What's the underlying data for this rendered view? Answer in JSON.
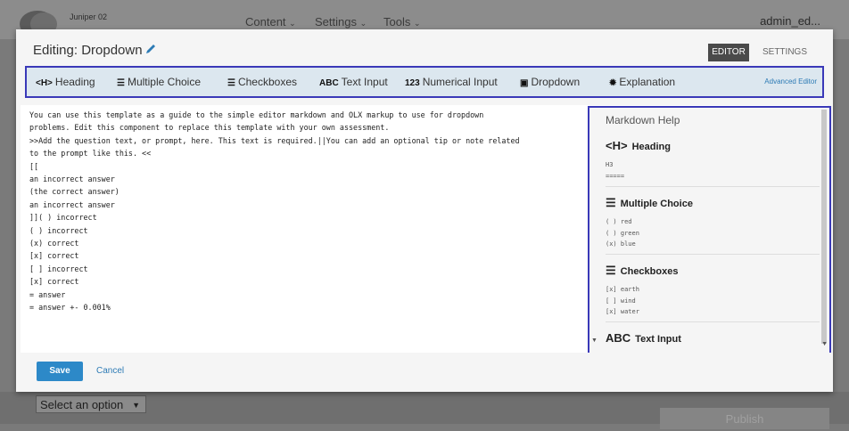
{
  "background": {
    "course_label": "Juniper 02",
    "nav": [
      "Content",
      "Settings",
      "Tools"
    ],
    "user": "admin_ed...",
    "select_value": "Select an option",
    "publish_label": "Publish"
  },
  "modal": {
    "title": "Editing: Dropdown",
    "tabs": {
      "editor": "EDITOR",
      "settings": "SETTINGS"
    }
  },
  "toolbar": {
    "items": [
      {
        "icon": "<H>",
        "label": "Heading"
      },
      {
        "icon": "☰",
        "label": "Multiple Choice"
      },
      {
        "icon": "☰",
        "label": "Checkboxes"
      },
      {
        "icon": "ABC",
        "label": "Text Input"
      },
      {
        "icon": "123",
        "label": "Numerical Input"
      },
      {
        "icon": "▣",
        "label": "Dropdown"
      },
      {
        "icon": "✹",
        "label": "Explanation"
      }
    ],
    "advanced_label": "Advanced Editor"
  },
  "editor": {
    "content": "You can use this template as a guide to the simple editor markdown and OLX markup to use for dropdown\nproblems. Edit this component to replace this template with your own assessment.\n>>Add the question text, or prompt, here. This text is required.||You can add an optional tip or note related\nto the prompt like this. <<\n[[\nan incorrect answer\n(the correct answer)\nan incorrect answer\n]]( ) incorrect\n( ) incorrect\n(x) correct\n[x] correct\n[ ] incorrect\n[x] correct\n= answer\n= answer +- 0.001%"
  },
  "markdown_help": {
    "title": "Markdown Help",
    "sections": [
      {
        "icon": "<H>",
        "heading": "Heading",
        "example": "H3\n====="
      },
      {
        "icon": "☰",
        "heading": "Multiple Choice",
        "example": "( ) red\n( ) green\n(x) blue"
      },
      {
        "icon": "☰",
        "heading": "Checkboxes",
        "example": "[x] earth\n[ ] wind\n[x] water"
      },
      {
        "icon": "ABC",
        "heading": "Text Input",
        "example": ""
      }
    ]
  },
  "footer": {
    "save_label": "Save",
    "cancel_label": "Cancel"
  }
}
